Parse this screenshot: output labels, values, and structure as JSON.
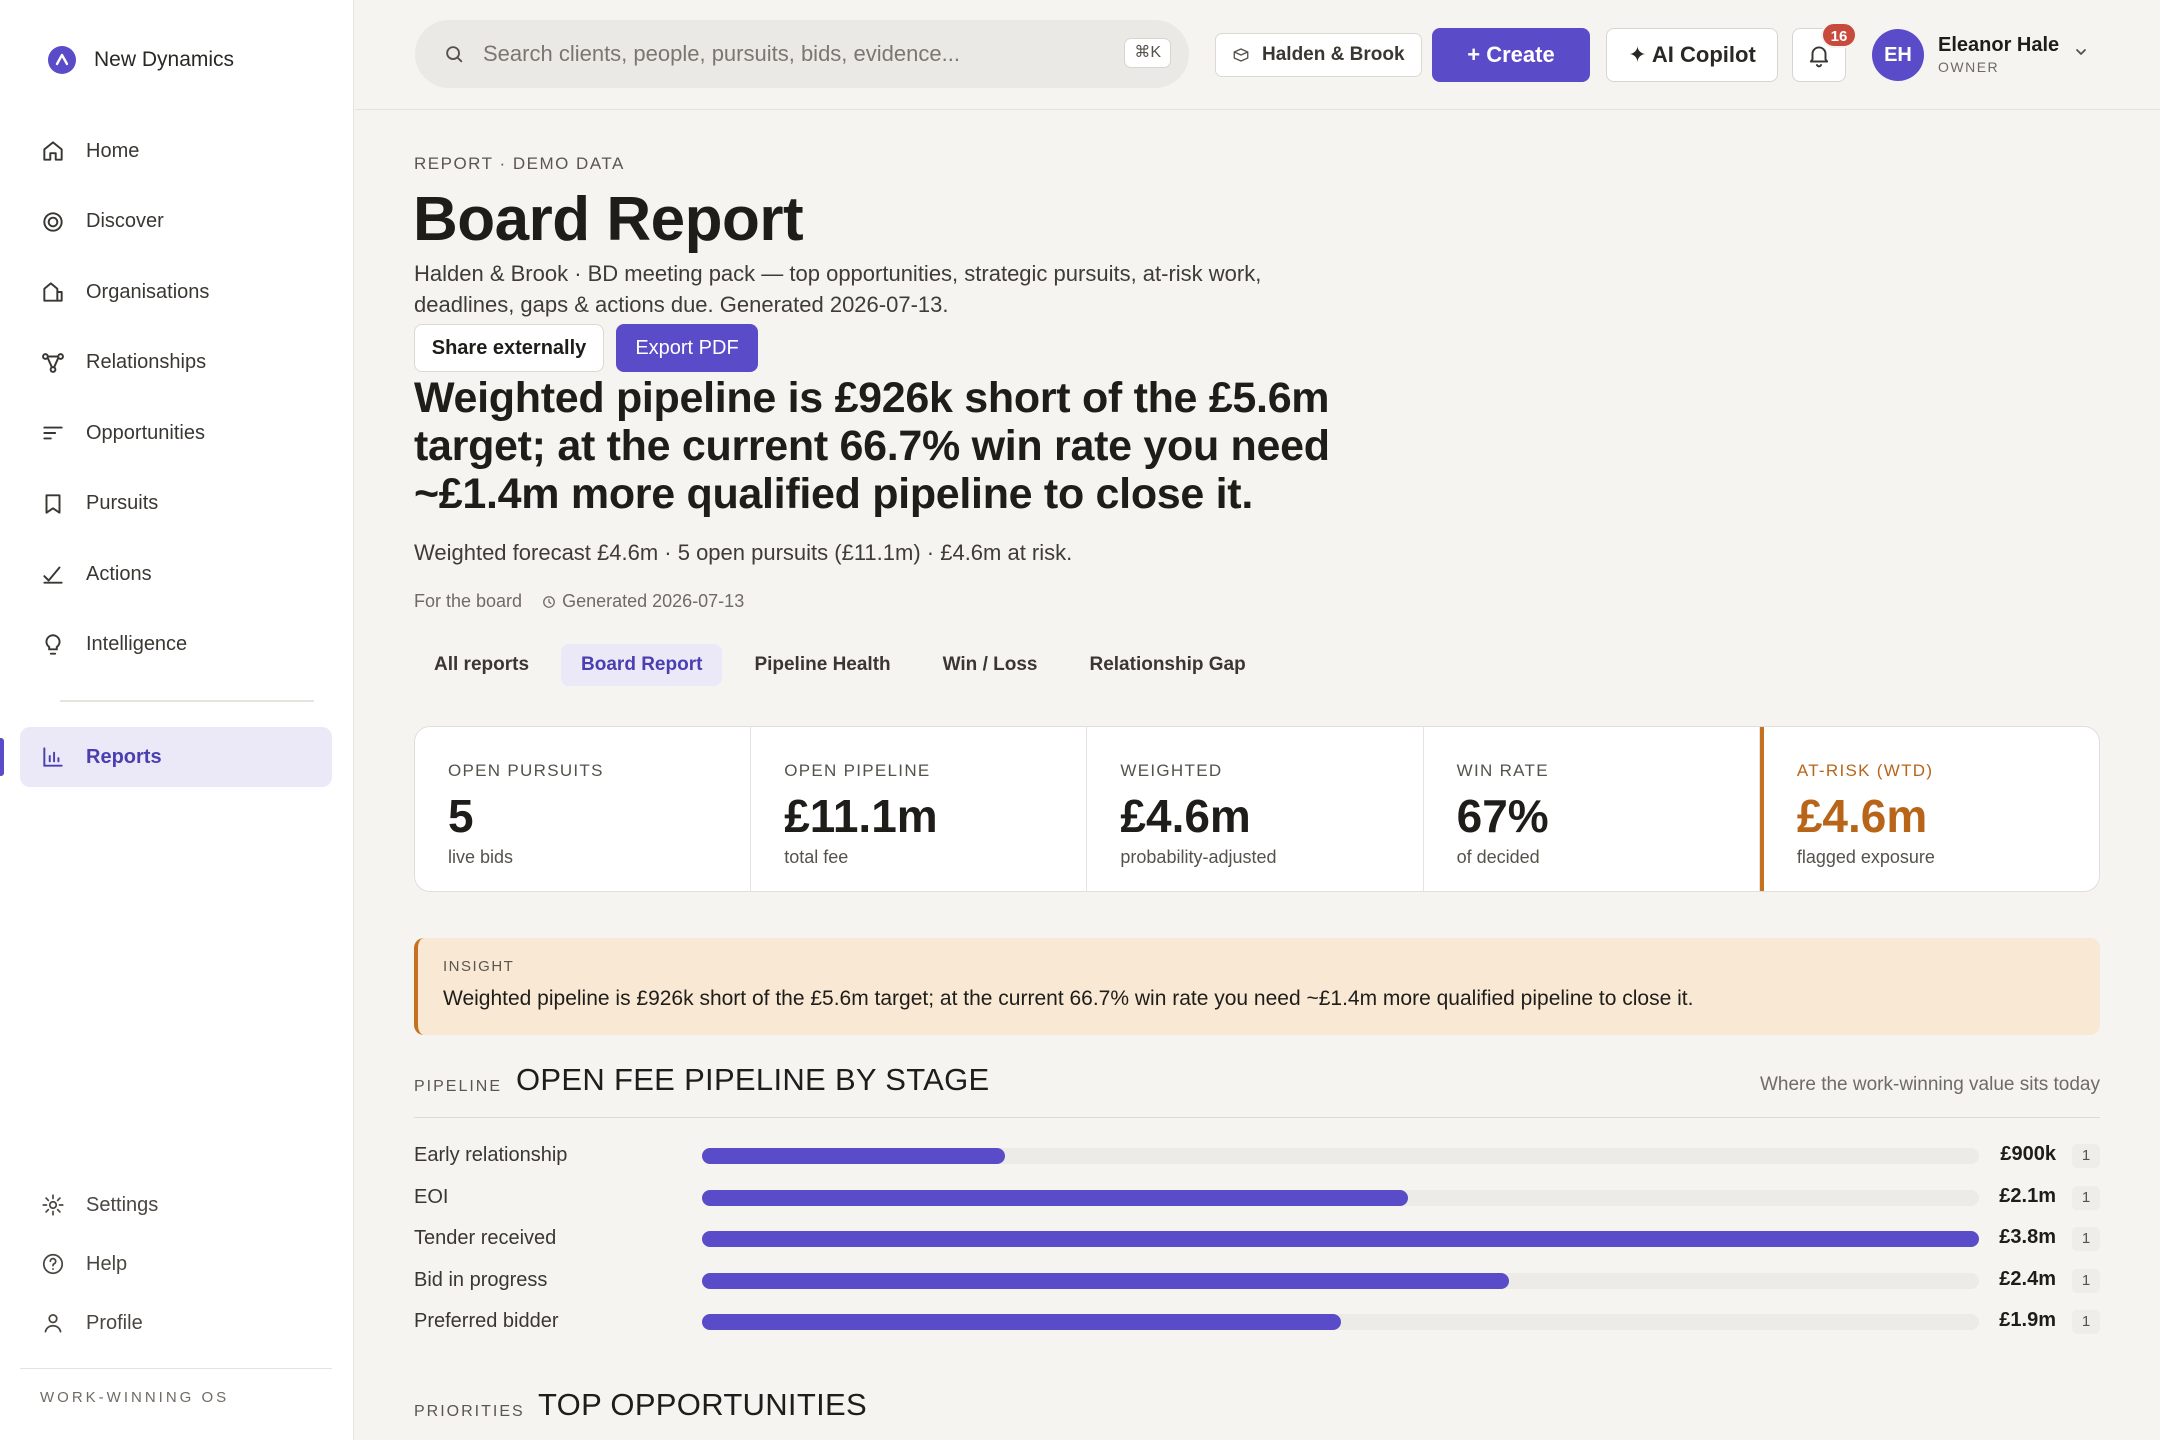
{
  "app": {
    "name": "New Dynamics",
    "footer": "WORK-WINNING OS"
  },
  "sidebar": {
    "items": [
      {
        "label": "Home",
        "icon": "home-icon"
      },
      {
        "label": "Discover",
        "icon": "target-icon"
      },
      {
        "label": "Organisations",
        "icon": "building-icon"
      },
      {
        "label": "Relationships",
        "icon": "network-icon"
      },
      {
        "label": "Opportunities",
        "icon": "list-icon"
      },
      {
        "label": "Pursuits",
        "icon": "bookmark-icon"
      },
      {
        "label": "Actions",
        "icon": "check-icon"
      },
      {
        "label": "Intelligence",
        "icon": "bulb-icon"
      }
    ],
    "active": {
      "label": "Reports",
      "icon": "bar-chart-icon"
    },
    "bottom": [
      {
        "label": "Settings",
        "icon": "gear-icon"
      },
      {
        "label": "Help",
        "icon": "help-icon"
      },
      {
        "label": "Profile",
        "icon": "user-icon"
      }
    ]
  },
  "topbar": {
    "search_placeholder": "Search clients, people, pursuits, bids, evidence...",
    "shortcut": "⌘K",
    "org": "Halden & Brook",
    "create": "+ Create",
    "copilot": "✦ AI Copilot",
    "notifications": "16",
    "user": {
      "initials": "EH",
      "name": "Eleanor Hale",
      "role": "OWNER"
    }
  },
  "page": {
    "eyebrow": "REPORT · DEMO DATA",
    "title": "Board Report",
    "subtitle": "Halden & Brook · BD meeting pack — top opportunities, strategic pursuits, at-risk work, deadlines, gaps & actions due. Generated 2026-07-13.",
    "share": "Share externally",
    "export": "Export PDF",
    "headline": "Weighted pipeline is £926k short of the £5.6m target; at the current 66.7% win rate you need ~£1.4m more qualified pipeline to close it.",
    "headline_sub": "Weighted forecast £4.6m · 5 open pursuits (£11.1m) · £4.6m at risk.",
    "audience": "For the board",
    "generated": "Generated 2026-07-13"
  },
  "tabs": [
    "All reports",
    "Board Report",
    "Pipeline Health",
    "Win / Loss",
    "Relationship Gap"
  ],
  "kpis": [
    {
      "label": "OPEN PURSUITS",
      "value": "5",
      "note": "live bids"
    },
    {
      "label": "OPEN PIPELINE",
      "value": "£11.1m",
      "note": "total fee"
    },
    {
      "label": "WEIGHTED",
      "value": "£4.6m",
      "note": "probability-adjusted"
    },
    {
      "label": "WIN RATE",
      "value": "67%",
      "note": "of decided"
    },
    {
      "label": "AT-RISK (WTD)",
      "value": "£4.6m",
      "note": "flagged exposure"
    }
  ],
  "insight": {
    "label": "INSIGHT",
    "text": "Weighted pipeline is £926k short of the £5.6m target; at the current 66.7% win rate you need ~£1.4m more qualified pipeline to close it."
  },
  "pipeline": {
    "kicker": "PIPELINE",
    "title": "OPEN FEE PIPELINE BY STAGE",
    "note": "Where the work-winning value sits today",
    "stages": [
      {
        "label": "Early relationship",
        "value": "£900k",
        "count": "1",
        "fraction": 0.237
      },
      {
        "label": "EOI",
        "value": "£2.1m",
        "count": "1",
        "fraction": 0.553
      },
      {
        "label": "Tender received",
        "value": "£3.8m",
        "count": "1",
        "fraction": 1.0
      },
      {
        "label": "Bid in progress",
        "value": "£2.4m",
        "count": "1",
        "fraction": 0.632
      },
      {
        "label": "Preferred bidder",
        "value": "£1.9m",
        "count": "1",
        "fraction": 0.5
      }
    ]
  },
  "priorities": {
    "kicker": "PRIORITIES",
    "title": "TOP OPPORTUNITIES"
  },
  "colors": {
    "accent": "#5a4bc8",
    "risk": "#b8651a",
    "insight_bg": "#f8e8d4"
  }
}
